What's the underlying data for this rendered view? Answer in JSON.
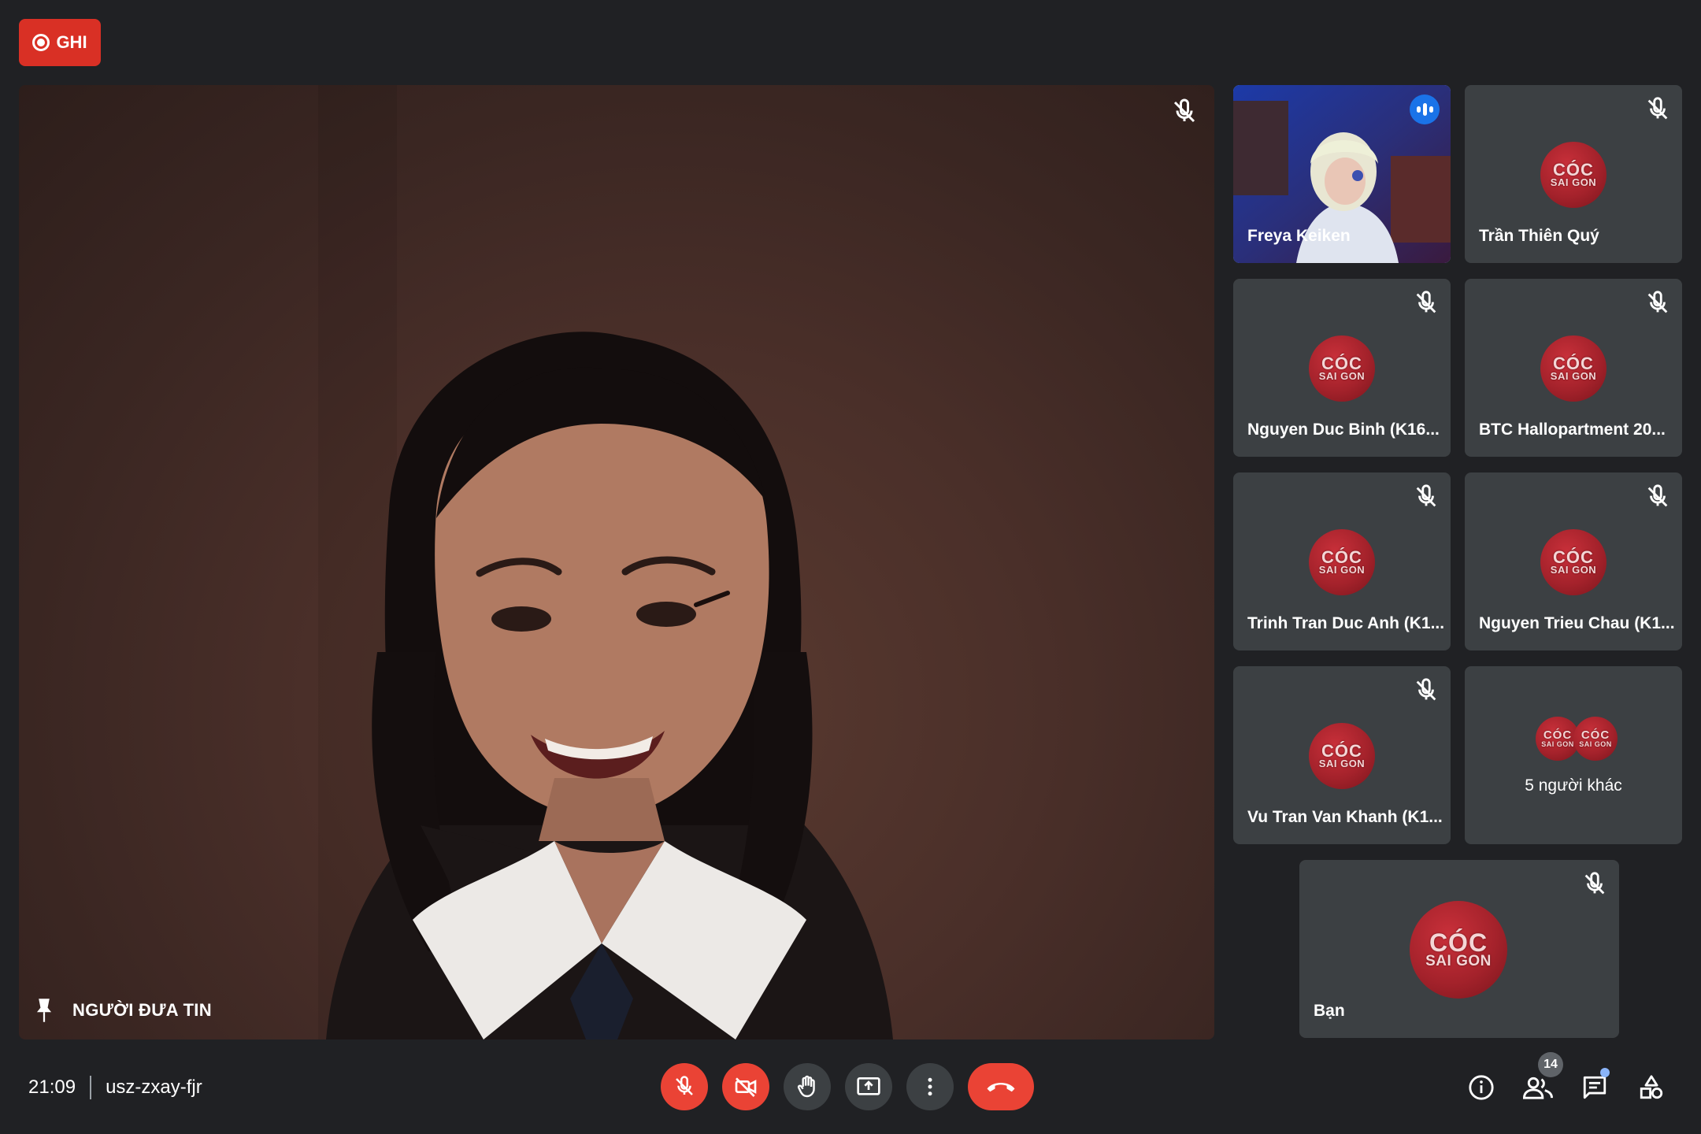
{
  "record": {
    "label": "GHI"
  },
  "main": {
    "pin_label": "NGƯỜI ĐƯA TIN"
  },
  "avatar": {
    "line1": "CÓC",
    "line2": "SAI GON"
  },
  "tiles": [
    {
      "name": "Freya Keiken"
    },
    {
      "name": "Trần Thiên Quý"
    },
    {
      "name": "Nguyen Duc Binh (K16..."
    },
    {
      "name": "BTC Hallopartment 20..."
    },
    {
      "name": "Trinh Tran Duc Anh (K1..."
    },
    {
      "name": "Nguyen Trieu Chau (K1..."
    },
    {
      "name": "Vu Tran Van Khanh (K1..."
    },
    {
      "name": "5 người khác"
    }
  ],
  "self": {
    "name": "Bạn"
  },
  "bottom": {
    "time": "21:09",
    "meeting_code": "usz-zxay-fjr",
    "participants_count": "14"
  },
  "colors": {
    "accent": "#8ab4f8",
    "danger": "#ea4335",
    "record": "#d93025",
    "tile": "#3c4043",
    "bg": "#202124"
  }
}
